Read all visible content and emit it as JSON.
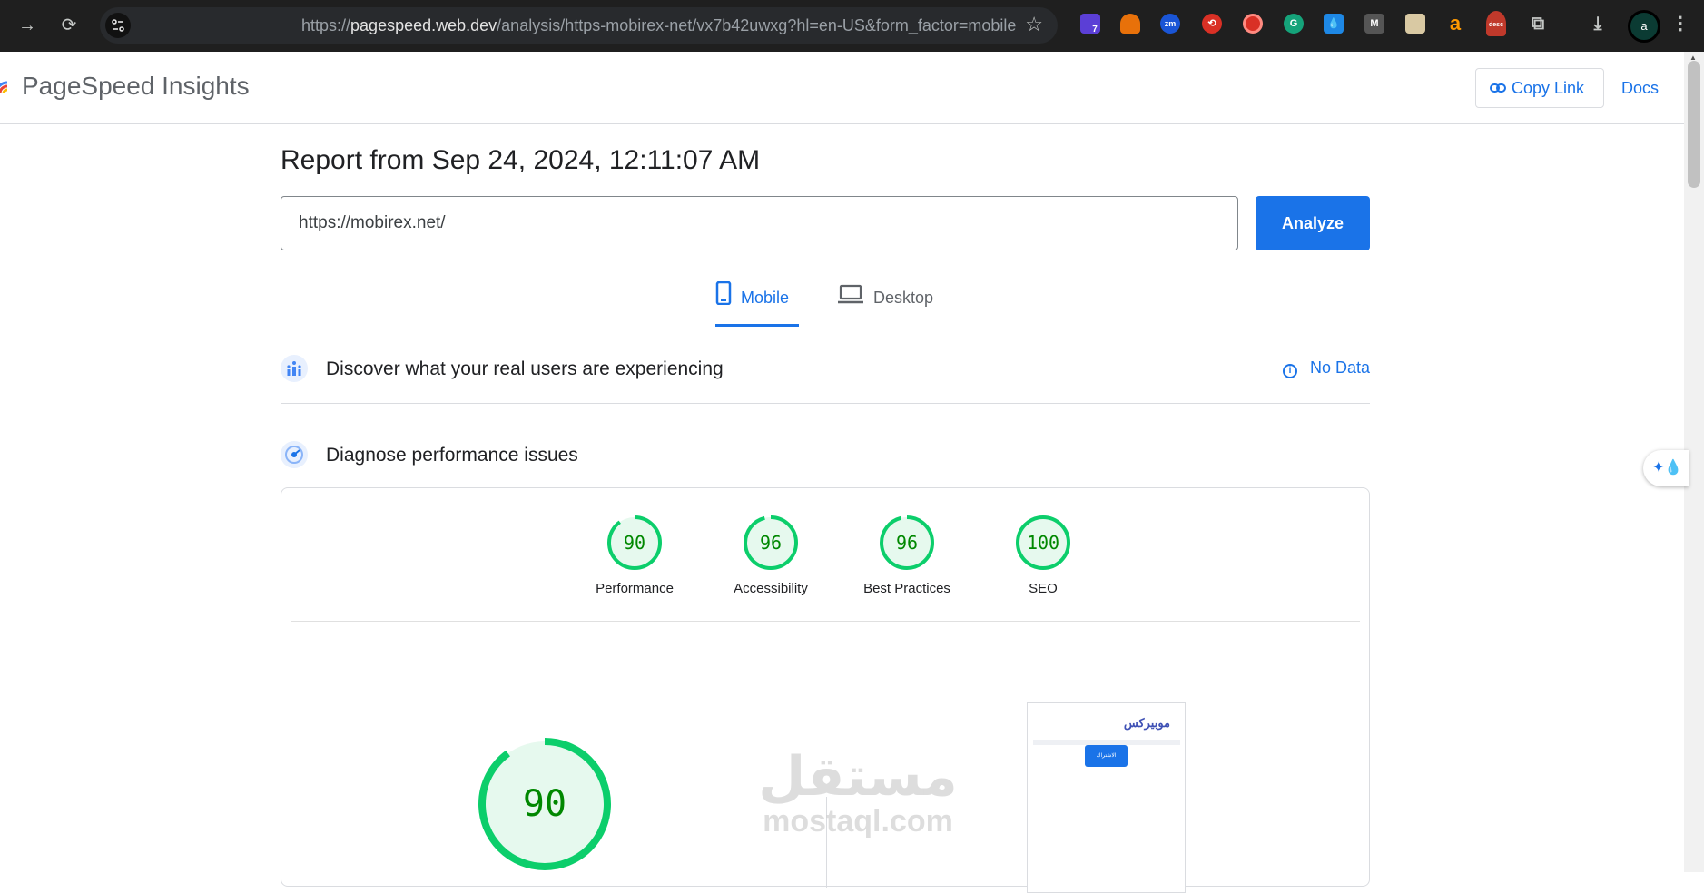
{
  "browser": {
    "url_prefix": "https://",
    "url_host": "pagespeed.web.dev",
    "url_path": "/analysis/https-mobirex-net/vx7b42uwxg?hl=en-US&form_factor=mobile",
    "profile_initial": "a",
    "ext_badge": "7",
    "ext_zm": "zm",
    "ext_desc": "desc",
    "ext_amazon": "a"
  },
  "header": {
    "title": "PageSpeed Insights",
    "copy_link": "Copy Link",
    "docs": "Docs"
  },
  "report": {
    "title": "Report from Sep 24, 2024, 12:11:07 AM",
    "url_value": "https://mobirex.net/",
    "analyze": "Analyze"
  },
  "tabs": {
    "mobile": "Mobile",
    "desktop": "Desktop"
  },
  "real_users": {
    "title": "Discover what your real users are experiencing",
    "status": "No Data"
  },
  "diagnose": {
    "title": "Diagnose performance issues"
  },
  "scores": [
    {
      "label": "Performance",
      "value": 90
    },
    {
      "label": "Accessibility",
      "value": 96
    },
    {
      "label": "Best Practices",
      "value": 96
    },
    {
      "label": "SEO",
      "value": 100
    }
  ],
  "main_score": 90,
  "screenshot": {
    "site_title": "موبيركس",
    "button": "الاشتراك"
  },
  "watermark": {
    "arabic": "مستقل",
    "latin": "mostaql.com"
  },
  "colors": {
    "accent": "#1a73e8",
    "pass": "#0cce6b",
    "pass_text": "#008800",
    "pass_fill": "#e6f9ee"
  }
}
